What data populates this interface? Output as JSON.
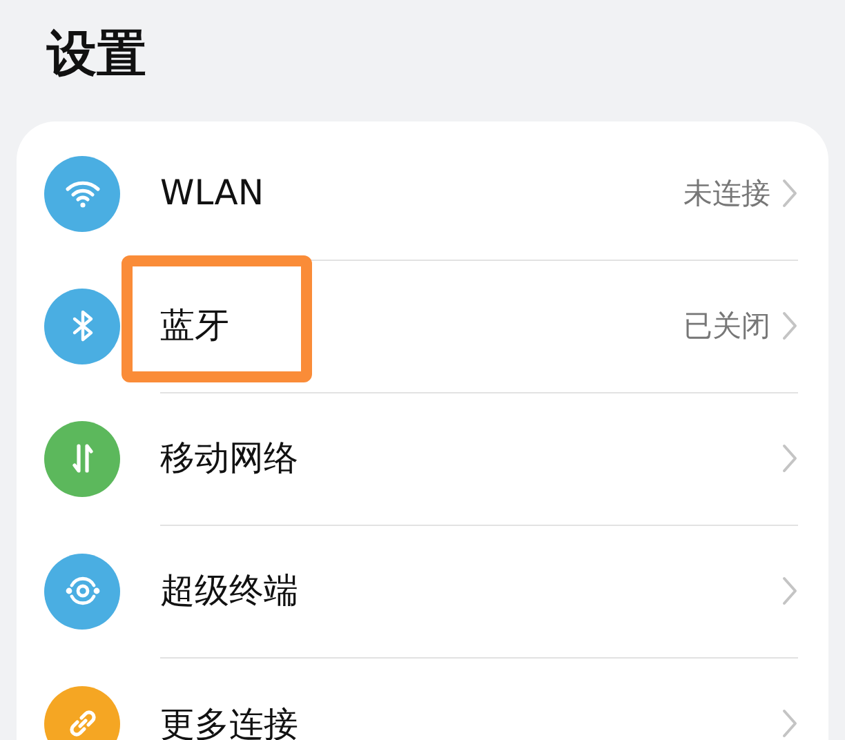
{
  "title": "设置",
  "items": [
    {
      "kind": "wifi",
      "label": "WLAN",
      "value": "未连接",
      "color": "#4aaee2",
      "highlighted": false
    },
    {
      "kind": "bluetooth",
      "label": "蓝牙",
      "value": "已关闭",
      "color": "#4aaee2",
      "highlighted": true
    },
    {
      "kind": "mobile",
      "label": "移动网络",
      "color": "#5cb85c",
      "highlighted": false
    },
    {
      "kind": "device",
      "label": "超级终端",
      "color": "#4aaee2",
      "highlighted": false
    },
    {
      "kind": "link",
      "label": "更多连接",
      "color": "#f5a623",
      "highlighted": false
    }
  ]
}
